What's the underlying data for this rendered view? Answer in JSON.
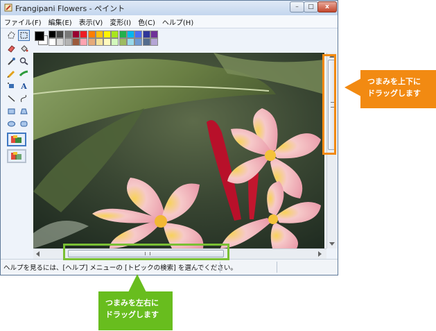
{
  "window": {
    "title": "Frangipani Flowers - ペイント",
    "buttons": {
      "minimize": "–",
      "maximize": "□",
      "close": "x"
    }
  },
  "menu": [
    "ファイル(F)",
    "編集(E)",
    "表示(V)",
    "変形(I)",
    "色(C)",
    "ヘルプ(H)"
  ],
  "palette": {
    "foreground": "#000000",
    "background": "#ffffff",
    "row1": [
      "#000000",
      "#464646",
      "#787878",
      "#990030",
      "#ed1c24",
      "#ff7e00",
      "#ffc20e",
      "#fff200",
      "#a8e61d",
      "#22b14c",
      "#00b7ef",
      "#4d6df3",
      "#2f3699",
      "#6f3198"
    ],
    "row2": [
      "#ffffff",
      "#dcdcdc",
      "#b4b4b4",
      "#9c5a3c",
      "#ffa3b1",
      "#e5aa7a",
      "#f5e49c",
      "#fff9bd",
      "#d3f9bc",
      "#9dbb61",
      "#99d9ea",
      "#709ad1",
      "#546d8e",
      "#b5a5d5"
    ]
  },
  "status": {
    "help_text": "ヘルプを見るには、[ヘルプ] メニューの [トピックの検索] を選んでください。"
  },
  "callouts": {
    "vertical": [
      "つまみを上下に",
      "ドラッグします"
    ],
    "horizontal": [
      "つまみを左右に",
      "ドラッグします"
    ]
  },
  "colors": {
    "vertical_highlight": "#f28a12",
    "horizontal_highlight": "#7ac034"
  }
}
